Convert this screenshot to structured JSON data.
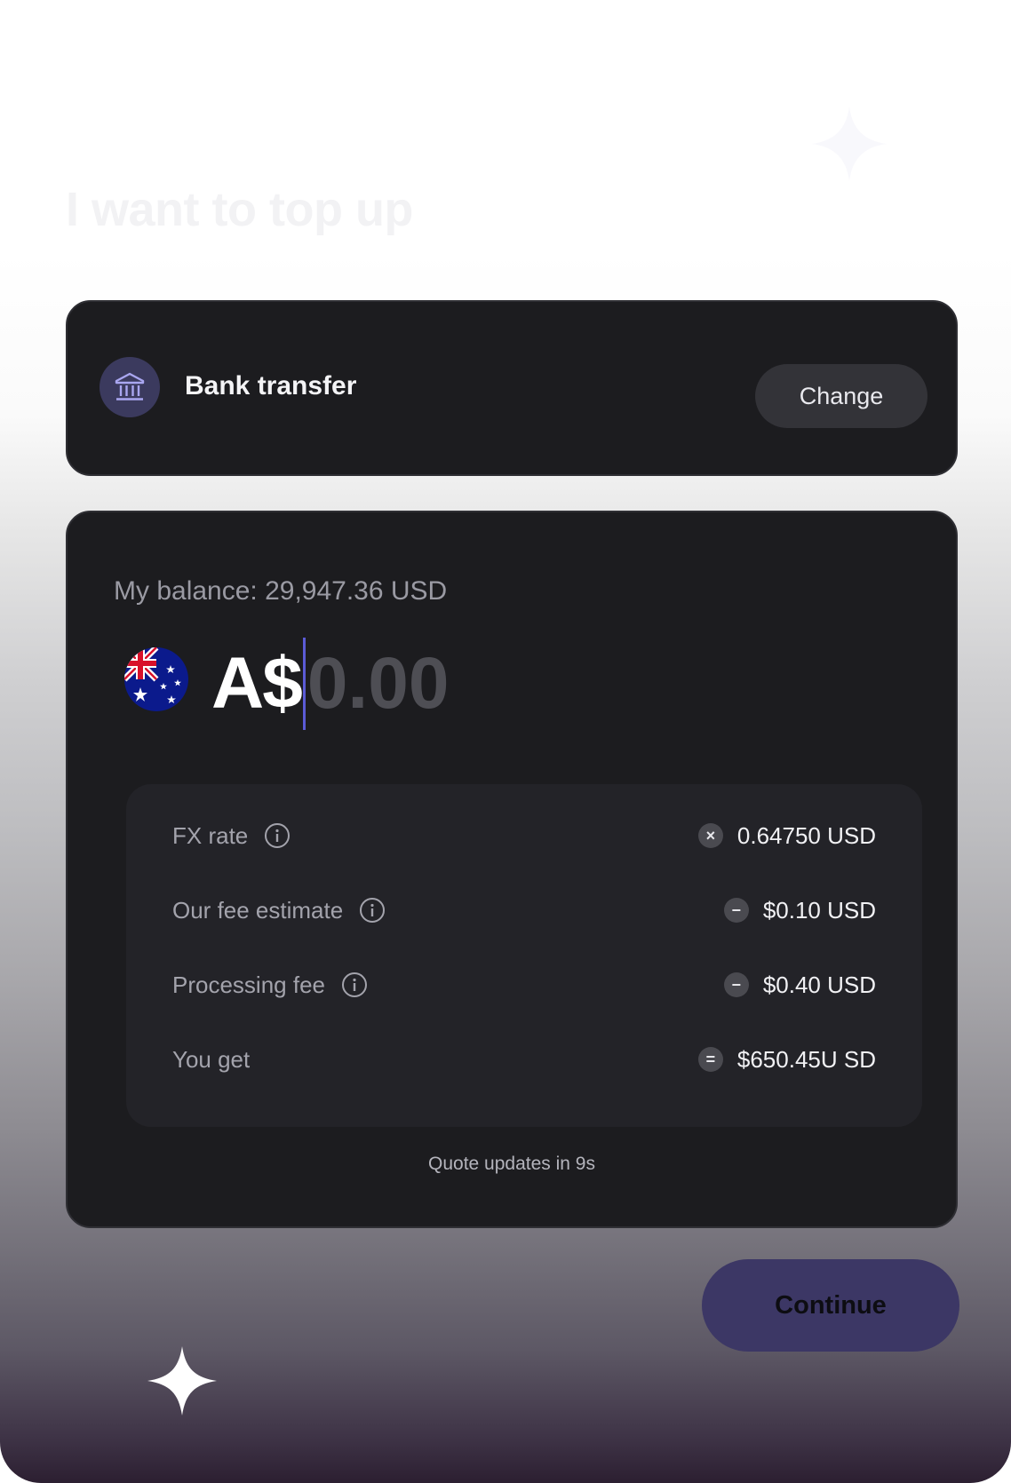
{
  "header": {
    "title": "I want to top up"
  },
  "payment_method": {
    "icon": "bank-icon",
    "label": "Bank transfer",
    "change_label": "Change"
  },
  "amount": {
    "balance_text": "My balance: 29,947.36 USD",
    "currency_flag": "australia-flag-icon",
    "currency_symbol": "A$",
    "placeholder": "0.00",
    "value": ""
  },
  "quote": {
    "rows": [
      {
        "label": "FX rate",
        "has_info": true,
        "operator": "×",
        "operator_icon": "multiply-icon",
        "value": "0.64750 USD"
      },
      {
        "label": "Our fee estimate",
        "has_info": true,
        "operator": "−",
        "operator_icon": "minus-icon",
        "value": "$0.10 USD"
      },
      {
        "label": "Processing fee",
        "has_info": true,
        "operator": "−",
        "operator_icon": "minus-icon",
        "value": "$0.40 USD"
      },
      {
        "label": "You get",
        "has_info": false,
        "operator": "=",
        "operator_icon": "equals-icon",
        "value": "$650.45U SD"
      }
    ],
    "updates_text": "Quote updates in 9s"
  },
  "actions": {
    "continue_label": "Continue"
  },
  "colors": {
    "card_bg": "#1c1c1f",
    "accent": "#5b5bd6",
    "continue_bg": "#3c3765",
    "bank_icon_bg": "#3b3a5e"
  }
}
